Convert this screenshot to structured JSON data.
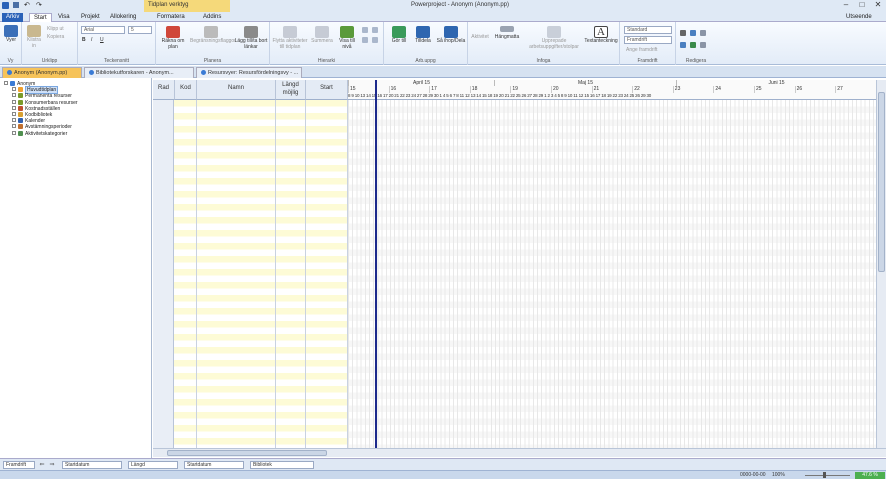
{
  "titlebar": {
    "title": "Powerproject - Anonym (Anonym.pp)",
    "context_tab": "Tidplan verktyg",
    "minimize": "–",
    "maximize": "□",
    "close": "✕"
  },
  "menu": {
    "file": "Arkiv",
    "tabs": [
      "Start",
      "Visa",
      "Projekt",
      "Allokering",
      "Formatera",
      "Addins"
    ],
    "right": "Utseende"
  },
  "ribbon": {
    "groups": [
      {
        "label": "Vy",
        "buttons": [
          "Vyer"
        ]
      },
      {
        "label": "Urklipp",
        "buttons": [
          "Klistra in",
          "Klipp ut",
          "Kopiera"
        ]
      },
      {
        "label": "Teckensnitt",
        "font": "Arial",
        "size": "5",
        "styles": [
          "B",
          "I",
          "U"
        ]
      },
      {
        "label": "Planera",
        "buttons": [
          "Räkna om plan",
          "Begränsningsflaggor",
          "Lägg till/ta bort länkar"
        ]
      },
      {
        "label": "Hierarki",
        "buttons": [
          "Flytta aktiviteter till tidplan",
          "Summera",
          "Visa till nivå"
        ]
      },
      {
        "label": "Arb.uppg",
        "buttons": [
          "Gör till",
          "Tilldela",
          "Så ihop/Dela"
        ]
      },
      {
        "label": "Infoga",
        "buttons": [
          "Aktivitet",
          "Hängmatta",
          "Upprepade arbetsuppgifter/stolpar",
          "Textanteckning"
        ]
      },
      {
        "label": "Framdrift",
        "combo1": "Standard",
        "combo2": "Framdrift",
        "button": "Ange framdrift"
      },
      {
        "label": "Redigera",
        "buttons": []
      }
    ]
  },
  "doctabs": [
    {
      "label": "Anonym (Anonym.pp)",
      "active": true
    },
    {
      "label": "Bibliotekutforskaren - Anonym...",
      "active": false
    },
    {
      "label": "Resursvyer: Resursfördelningsvy - ...",
      "active": false
    }
  ],
  "tree": [
    {
      "label": "Anonym",
      "level": 0,
      "color": "#3a7bd5"
    },
    {
      "label": "Huvudtidplan",
      "level": 1,
      "color": "#f0a030",
      "selected": true
    },
    {
      "label": "Permanenta resurser",
      "level": 1,
      "color": "#7a9a2a"
    },
    {
      "label": "Konsumerbara resurser",
      "level": 1,
      "color": "#7a9a2a"
    },
    {
      "label": "Kostnadsställen",
      "level": 1,
      "color": "#c05030"
    },
    {
      "label": "Kodbibliotek",
      "level": 1,
      "color": "#d8a030"
    },
    {
      "label": "Kalender",
      "level": 1,
      "color": "#3060b0"
    },
    {
      "label": "Avstämningsperioder",
      "level": 1,
      "color": "#c07030"
    },
    {
      "label": "Aktivitetskategorier",
      "level": 1,
      "color": "#509050"
    }
  ],
  "grid": {
    "columns": [
      "Rad",
      "Kod",
      "Namn",
      "Längd\nmöjlig",
      "Start"
    ]
  },
  "gantt": {
    "months": [
      "April 15",
      "Maj 15",
      "Juni 15"
    ],
    "weeks": [
      "15",
      "16",
      "17",
      "18",
      "19",
      "20",
      "21",
      "22",
      "23",
      "24",
      "25",
      "26",
      "27"
    ],
    "days": "8 9 10 13 14 15 16 17 20 21 22 23 24 27 28 29 30 1 4 5 6 7 8 11 12 13 14 15 18 19 20 21 22 25 26 27 28 29 1 2 3 4 5 8 9 10 11 12 15 16 17 18 19 22 23 24 25 26 29 30"
  },
  "filterbar": {
    "filter": "Framdrift",
    "sort1": "Startdatum",
    "sort2": "Längd",
    "sort3": "Startdatum",
    "library": "Bibliotek"
  },
  "statusbar": {
    "date": "0000-00-00",
    "zoom": "100%",
    "progress": "47.6 %"
  },
  "colors": {
    "accent": "#2a62b8",
    "active_doctab": "#f6c35a",
    "today_line": "#1d2a8c",
    "row_yellow": "#fdfbd6"
  }
}
